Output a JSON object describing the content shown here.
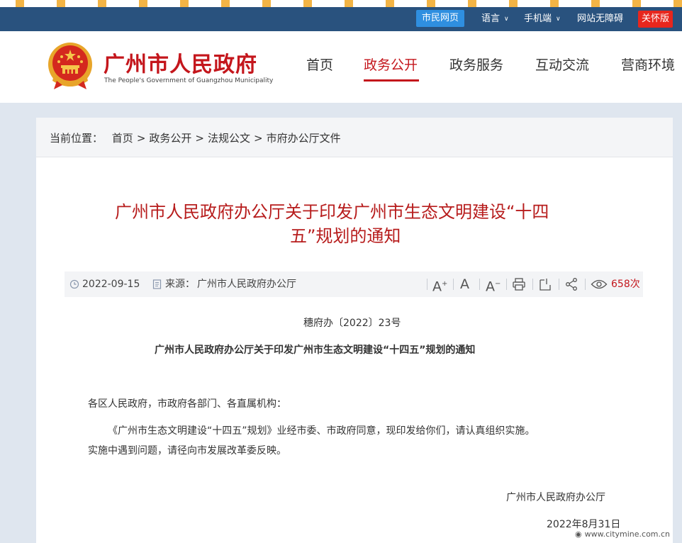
{
  "topbar": {
    "citizen_page": "市民网页",
    "language": "语言",
    "mobile": "手机端",
    "accessibility": "网站无障碍",
    "caring_version": "关怀版"
  },
  "header": {
    "site_title": "广州市人民政府",
    "site_subtitle": "The People's Government of Guangzhou Municipality",
    "nav": [
      "首页",
      "政务公开",
      "政务服务",
      "互动交流",
      "营商环境"
    ],
    "active_nav": "政务公开"
  },
  "breadcrumb": {
    "label": "当前位置：",
    "items": [
      "首页",
      "政务公开",
      "法规公文",
      "市府办公厅文件"
    ]
  },
  "article": {
    "title_line1": "广州市人民政府办公厅关于印发广州市生态文明建设“十四",
    "title_line2": "五”规划的通知",
    "date": "2022-09-15",
    "source_label": "来源：",
    "source": "广州市人民政府办公厅",
    "view_count": "658",
    "view_unit": "次",
    "font_increase": "A",
    "font_reset": "A",
    "font_decrease": "A",
    "doc_number": "穗府办〔2022〕23号",
    "subtitle": "广州市人民政府办公厅关于印发广州市生态文明建设“十四五”规划的通知",
    "salutation": "各区人民政府，市政府各部门、各直属机构：",
    "body_line1": "《广州市生态文明建设“十四五”规划》业经市委、市政府同意，现印发给你们，请认真组织实施。",
    "body_line2": "实施中遇到问题，请径向市发展改革委反映。",
    "issuer": "广州市人民政府办公厅",
    "issue_date": "2022年8月31日"
  },
  "watermark": "www.citymine.com.cn",
  "colors": {
    "topbar": "#29527e",
    "accent_red": "#c4161c",
    "citizen_blue": "#2f8fe0"
  }
}
